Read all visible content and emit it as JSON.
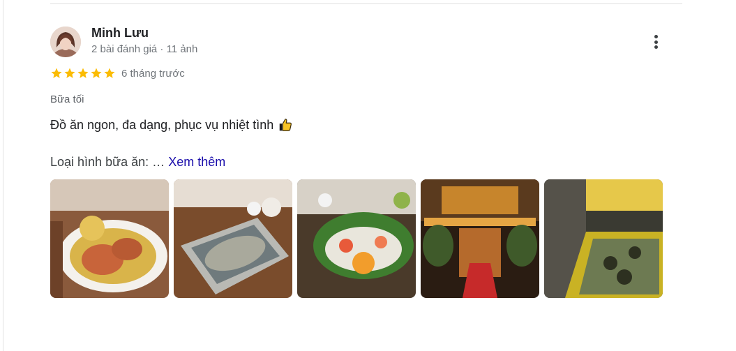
{
  "review": {
    "author": "Minh Lưu",
    "stats": "2 bài đánh giá · 11 ảnh",
    "rating": 5,
    "time": "6 tháng trước",
    "meal": "Bữa tối",
    "text": "Đồ ăn ngon, đa dạng, phục vụ nhiệt tình",
    "detail_prefix": "Loại hình bữa ăn: …",
    "see_more": "Xem thêm"
  },
  "colors": {
    "star": "#fbbc04",
    "link": "#1a0dab"
  },
  "icons": {
    "more": "more-vert-icon",
    "star": "star-icon",
    "thumbs_up": "thumbs-up-icon"
  },
  "photos": [
    {
      "name": "photo-fried-crab"
    },
    {
      "name": "photo-steamed-fish"
    },
    {
      "name": "photo-seafood-platter"
    },
    {
      "name": "photo-restaurant-entrance"
    },
    {
      "name": "photo-seafood-tank"
    }
  ]
}
